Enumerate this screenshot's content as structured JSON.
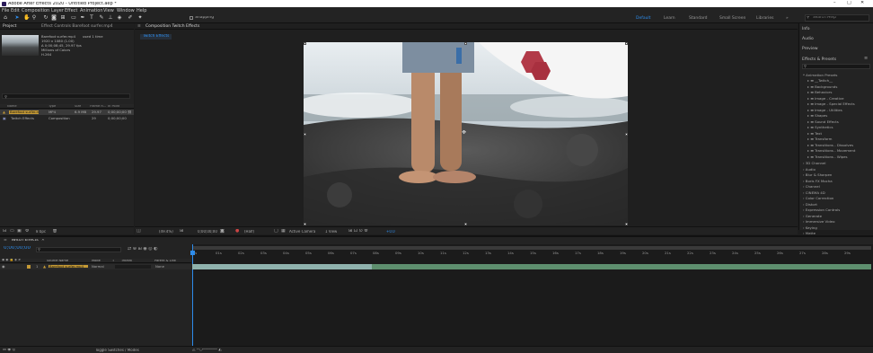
{
  "window": {
    "title": "Adobe After Effects 2020 - Untitled Project.aep *"
  },
  "menu": [
    "File",
    "Edit",
    "Composition",
    "Layer",
    "Effect",
    "Animation",
    "View",
    "Window",
    "Help"
  ],
  "toolbar": {
    "snapping_label": "Snapping",
    "workspaces": [
      "Default",
      "Learn",
      "Standard",
      "Small Screen",
      "Libraries"
    ],
    "search_placeholder": "Search Help"
  },
  "project_panel": {
    "tabs": [
      "Project",
      "Effect Controls Barefoot surfer.mp4"
    ],
    "footage_info": {
      "name": "Barefoot surfer.mp4",
      "used": "used 1 time",
      "dimensions": "1920 x 1080 (1.00)",
      "duration": "Δ 0;00;08;45, 29.97 fps",
      "colors": "Millions of Colors",
      "codec": "H.264"
    },
    "columns": [
      "Name",
      "Type",
      "Size",
      "Frame R...",
      "In Point"
    ],
    "rows": [
      {
        "name": "Barefoot surfer.mp4",
        "type": "MP4",
        "size": "6.9 MB",
        "frame_rate": "29.97",
        "in_point": "0;00;00;00"
      },
      {
        "name": "Twitch Effects",
        "type": "Composition",
        "size": "",
        "frame_rate": "29",
        "in_point": "0;00;00;00"
      }
    ],
    "bpc_label": "8 bpc"
  },
  "viewer": {
    "tab_label": "Composition Twitch Effects",
    "comp_chip": "Twitch Effects",
    "zoom": "(49.4%)",
    "timecode": "0;00;00;00",
    "resolution": "(Half)",
    "camera": "Active Camera",
    "views": "1 View",
    "exposure": "+0.0"
  },
  "right_panel": {
    "info": "Info",
    "audio": "Audio",
    "preview": "Preview",
    "effects_title": "Effects & Presets",
    "animation_presets": "* Animation Presets",
    "presets": [
      "__Twitch__",
      "Backgrounds",
      "Behaviors",
      "Image - Creative",
      "Image - Special Effects",
      "Image - Utilities",
      "Shapes",
      "Sound Effects",
      "Synthetics",
      "Text",
      "Transform",
      "Transitions - Dissolves",
      "Transitions - Movement",
      "Transitions - Wipes"
    ],
    "categories": [
      "3D Channel",
      "Audio",
      "Blur & Sharpen",
      "Boris FX Mocha",
      "Channel",
      "CINEMA 4D",
      "Color Correction",
      "Distort",
      "Expression Controls",
      "Generate",
      "Immersive Video",
      "Keying",
      "Matte"
    ]
  },
  "timeline": {
    "tab_label": "Twitch Effects",
    "timecode": "0;00;00;00",
    "columns": [
      "Source Name",
      "Mode",
      "T",
      "TrkMat",
      "Parent & Link"
    ],
    "layer": {
      "index": "1",
      "name": "Barefoot surfer.mp4",
      "mode": "Normal",
      "parent": "None"
    },
    "ruler_ticks": [
      "0s",
      "01s",
      "02s",
      "03s",
      "04s",
      "05s",
      "06s",
      "07s",
      "08s",
      "09s",
      "10s",
      "11s",
      "12s",
      "13s",
      "14s",
      "15s",
      "16s",
      "17s",
      "18s",
      "19s",
      "20s",
      "21s",
      "22s",
      "23s",
      "24s",
      "25s",
      "26s",
      "27s",
      "28s",
      "29s"
    ],
    "toggle_label": "Toggle Switches / Modes"
  },
  "colors": {
    "accent_blue": "#2d8ceb",
    "layer_bar_green": "#5e8f6e",
    "layer_bar_teal": "#8fb2ad",
    "label_yellow": "#c59a35"
  }
}
